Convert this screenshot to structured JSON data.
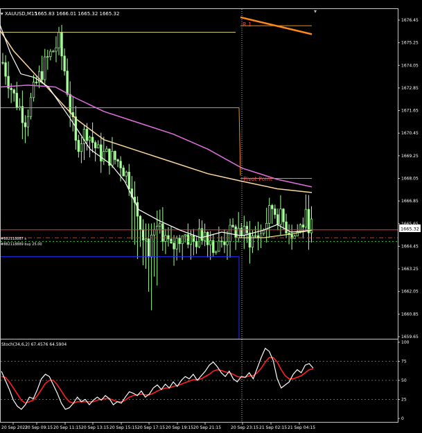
{
  "chart": {
    "title": "XAUUSD,M15",
    "ohlc": "1665.83 1666.01 1665.32 1665.32",
    "current_price": "1665.32",
    "price_ticks": [
      "1676.45",
      "1675.25",
      "1674.05",
      "1672.85",
      "1671.65",
      "1670.45",
      "1669.25",
      "1668.05",
      "1666.85",
      "1665.65",
      "1664.45",
      "1663.25",
      "1662.05",
      "1660.85",
      "1659.65"
    ],
    "time_ticks": [
      "20 Sep 2022",
      "20 Sep 09:15",
      "20 Sep 11:15",
      "20 Sep 13:15",
      "20 Sep 15:15",
      "20 Sep 17:15",
      "20 Sep 19:15",
      "20 Sep 21:15",
      "20 Sep 23:15",
      "21 Sep 02:15",
      "21 Sep 04:15"
    ],
    "pivot_label": "Pivot Point",
    "r1_label": "R 1",
    "order_labels": [
      "#882118887 s",
      "#882118889 buy 25.00"
    ]
  },
  "stoch": {
    "label": "Stoch(34,6,2) 67.4576 64.5904",
    "ticks": [
      "100",
      "75",
      "50",
      "25",
      "0"
    ]
  },
  "colors": {
    "background": "#000000",
    "candle": "#a6ff99",
    "price_line": "#ff3333",
    "ma_fast": "#ffffff",
    "ma_slow": "#ffd7a0",
    "ma_pink": "#e070e0",
    "pivot": "#ff8a00",
    "r1": "#ff8a1a",
    "stoch_main": "#ffffff",
    "stoch_signal": "#ff2020"
  }
}
